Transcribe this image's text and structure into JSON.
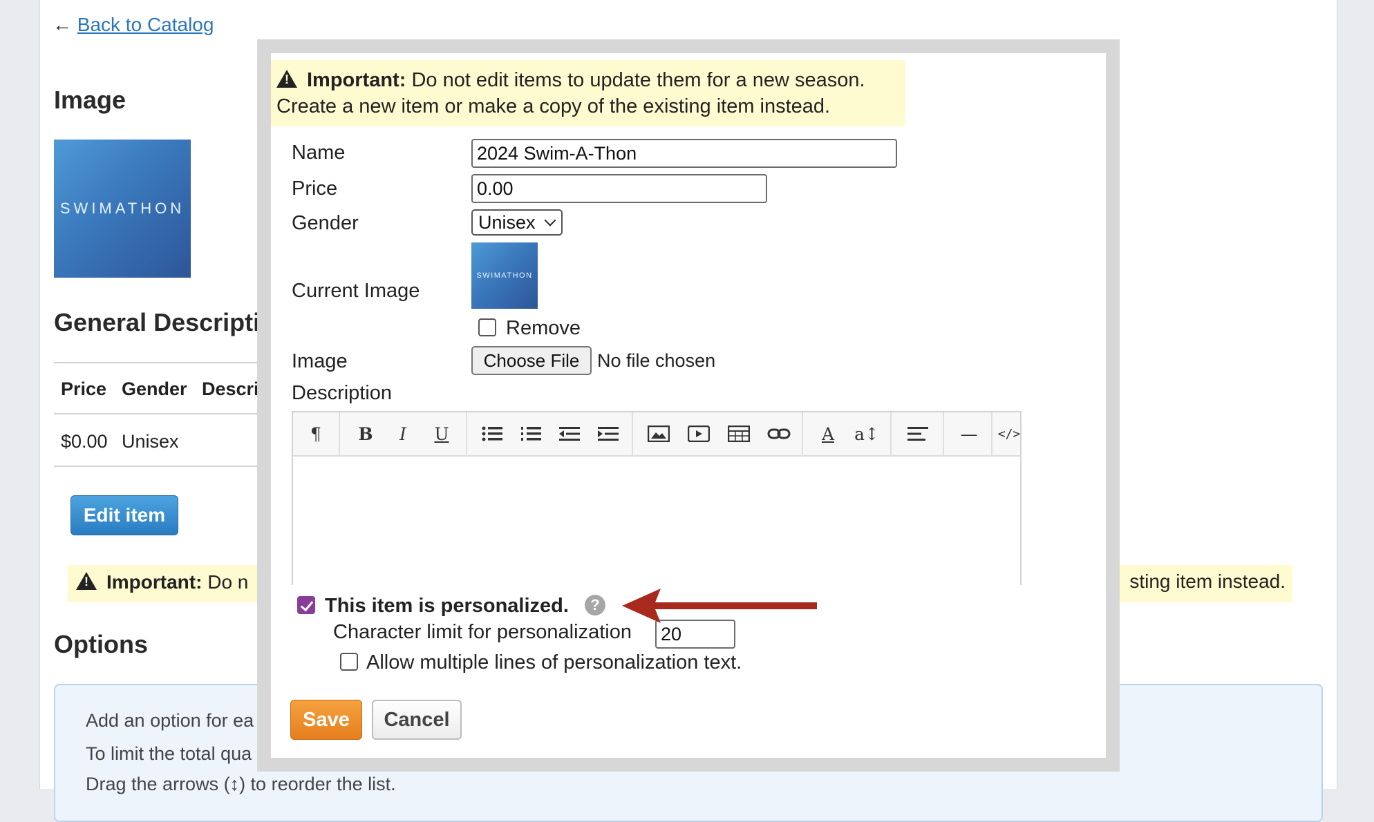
{
  "background": {
    "back_arrow": "←",
    "back_link": "Back to Catalog",
    "image_heading": "Image",
    "image_text": "SWIMATHON",
    "general_heading": "General Descripti",
    "table_headers": [
      "Price",
      "Gender",
      "Descri"
    ],
    "table_row": [
      "$0.00",
      "Unisex"
    ],
    "edit_button": "Edit item",
    "warning_prefix": "Important:",
    "warning_visible": "Do n",
    "warning_tail": "sting item instead.",
    "options_heading": "Options",
    "options_lines": [
      "Add an option for ea",
      "To limit the total qua",
      "Drag the arrows (↕) to reorder the list."
    ]
  },
  "modal": {
    "warning_bold": "Important:",
    "warning_line1": "Do not edit items to update them for a new season.",
    "warning_line2": "Create a new item or make a copy of the existing item instead.",
    "labels": {
      "name": "Name",
      "price": "Price",
      "gender": "Gender",
      "current_image": "Current Image",
      "image": "Image",
      "description": "Description"
    },
    "name_value": "2024 Swim-A-Thon",
    "price_value": "0.00",
    "gender_value": "Unisex",
    "current_image_text": "SWIMATHON",
    "remove_label": "Remove",
    "remove_checked": false,
    "choose_file": "Choose File",
    "no_file": "No file chosen",
    "toolbar_icons": [
      "paragraph-icon",
      "bold-icon",
      "italic-icon",
      "underline-icon",
      "bullet-list-icon",
      "numbered-list-icon",
      "outdent-icon",
      "indent-icon",
      "image-icon",
      "video-icon",
      "table-icon",
      "link-icon",
      "font-color-icon",
      "font-size-icon",
      "align-icon",
      "horizontal-rule-icon",
      "code-view-icon"
    ],
    "toolbar_glyphs": {
      "paragraph": "¶",
      "bold": "B",
      "italic": "I",
      "underline": "U",
      "font_color": "A",
      "font_size": "a↕",
      "code": "</>",
      "rule": "—"
    },
    "personalized_label": "This item is personalized.",
    "personalized_checked": true,
    "help_glyph": "?",
    "char_limit_label": "Character limit for personalization",
    "char_limit_value": "20",
    "multiline_label": "Allow multiple lines of personalization text.",
    "multiline_checked": false,
    "save": "Save",
    "cancel": "Cancel"
  },
  "colors": {
    "link": "#2a76b8",
    "warning_bg": "#fffbd0",
    "primary_button": "#2a7cc1",
    "save_button": "#e57e1e",
    "checkbox_checked": "#8a3c9a",
    "annotation_arrow": "#a82a1e"
  }
}
